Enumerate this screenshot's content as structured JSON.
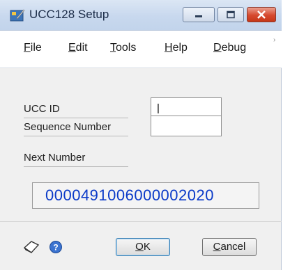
{
  "window": {
    "title": "UCC128 Setup"
  },
  "title_buttons": {
    "minimize": "minimize-icon",
    "maximize": "maximize-icon",
    "close": "close-icon"
  },
  "menu": {
    "items": [
      {
        "accel": "F",
        "rest": "ile"
      },
      {
        "accel": "E",
        "rest": "dit"
      },
      {
        "accel": "T",
        "rest": "ools"
      },
      {
        "accel": "H",
        "rest": "elp"
      },
      {
        "accel": "D",
        "rest": "ebug"
      }
    ]
  },
  "form": {
    "ucc_id_label": "UCC ID",
    "ucc_id_value": "|",
    "sequence_label": "Sequence Number",
    "sequence_value": "",
    "next_number_label": "Next Number",
    "next_number_value": "0000491006000002020"
  },
  "footer": {
    "ok_accel": "O",
    "ok_rest": "K",
    "cancel_accel": "C",
    "cancel_rest": "ancel",
    "icons": [
      "note-icon",
      "help-icon"
    ]
  },
  "colors": {
    "next_number_text": "#0a3ac8",
    "close_button": "#c63818"
  }
}
